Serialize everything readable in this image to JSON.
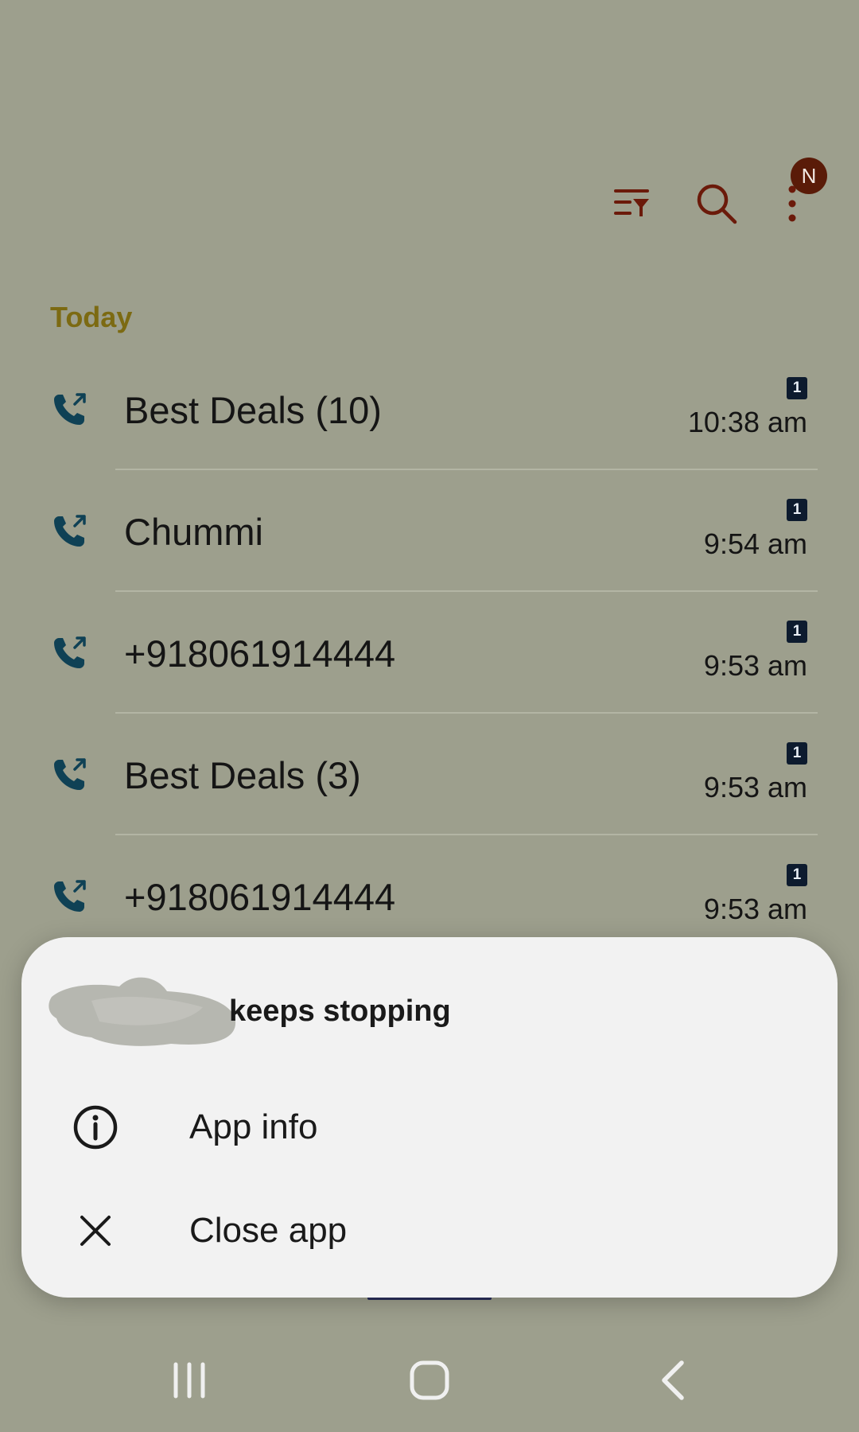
{
  "toolbar": {
    "filter_icon": "filter-list-icon",
    "search_icon": "search-icon",
    "more_icon": "more-vert-icon",
    "notification_badge": "N",
    "icon_color": "#6b1a0a"
  },
  "section": {
    "label": "Today",
    "label_color": "#7c6a12"
  },
  "calls": [
    {
      "name": "Best Deals (10)",
      "time": "10:38 am",
      "sim": "1",
      "icon": "outgoing-call-icon"
    },
    {
      "name": "Chummi",
      "time": "9:54 am",
      "sim": "1",
      "icon": "outgoing-call-icon"
    },
    {
      "name": "+918061914444",
      "time": "9:53 am",
      "sim": "1",
      "icon": "outgoing-call-icon"
    },
    {
      "name": "Best Deals (3)",
      "time": "9:53 am",
      "sim": "1",
      "icon": "outgoing-call-icon"
    },
    {
      "name": "+918061914444",
      "time": "9:53 am",
      "sim": "1",
      "icon": "outgoing-call-icon"
    }
  ],
  "dialog": {
    "title": "keeps stopping",
    "options": [
      {
        "label": "App info",
        "icon": "info-icon"
      },
      {
        "label": "Close app",
        "icon": "close-icon"
      }
    ]
  },
  "navbar": {
    "recents_icon": "recents-icon",
    "home_icon": "home-icon",
    "back_icon": "back-icon"
  },
  "colors": {
    "background": "#9d9f8d",
    "call_icon": "#0f4155",
    "dialog_bg": "#f2f2f2",
    "badge_bg": "#5a1b08"
  }
}
